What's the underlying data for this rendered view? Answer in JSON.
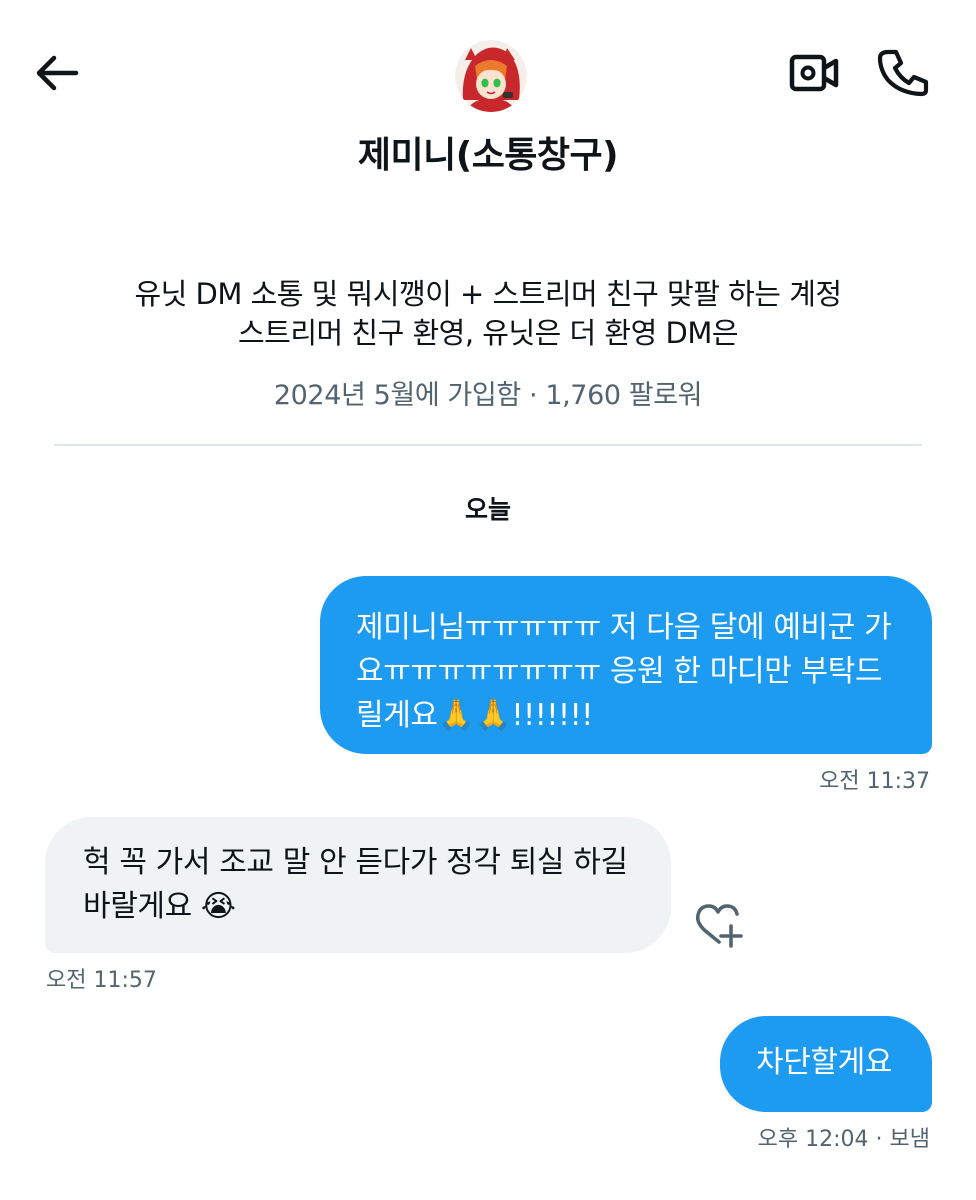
{
  "header": {
    "back_icon": "arrow-left-icon",
    "display_name": "제미니(소통창구)",
    "video_icon": "video-camera-icon",
    "call_icon": "phone-icon"
  },
  "profile": {
    "bio_line_1": "유닛 DM 소통 및 뭐시깽이 + 스트리머 친구 맞팔 하는 계정",
    "bio_line_2": "스트리머 친구 환영, 유닛은 더 환영 DM은",
    "joined": "2024년 5월에 가입함",
    "separator": "·",
    "followers": "1,760 팔로워"
  },
  "conversation": {
    "day_label": "오늘",
    "messages": [
      {
        "direction": "outgoing",
        "lines": [
          "제미니님ㅠㅠㅠㅠㅠ 저 다음 달에 예비군 가",
          "요ㅠㅠㅠㅠㅠㅠㅠㅠ 응원 한 마디만 부탁드",
          "릴게요🙏🙏!!!!!!!"
        ],
        "time": "오전 11:37"
      },
      {
        "direction": "incoming",
        "lines": [
          "헉 꼭 가서 조교 말 안 듣다가 정각 퇴실 하길",
          "바랄게요 😭"
        ],
        "time": "오전 11:57",
        "reaction_icon": "heart-plus-icon"
      },
      {
        "direction": "outgoing",
        "lines": [
          "차단할게요"
        ],
        "time": "오후 12:04 · 보냄"
      }
    ]
  },
  "colors": {
    "accent": "#1d9bf0",
    "incoming_bubble": "#eff3f4",
    "secondary_text": "#536471",
    "divider": "#e1e8ed"
  }
}
